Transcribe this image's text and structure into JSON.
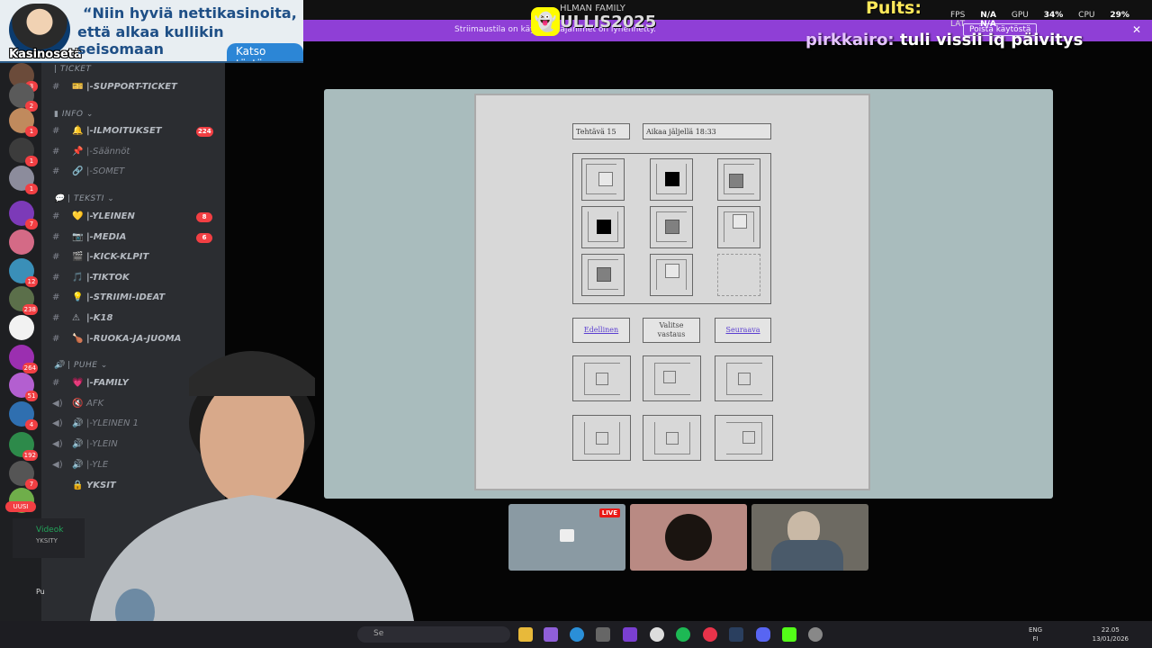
{
  "ad": {
    "logo": "Kasinosetä",
    "line1": "“Niin hyviä nettikasinoita,",
    "line2": "että alkaa kullikin seisomaan",
    "cta": "Katso tästä"
  },
  "topbar": {
    "group_name": "HLMAN FAMILY",
    "stream_username": "ULLIS2025"
  },
  "stream_banner": {
    "message": "Striimaustila on käy… …ttajanimet on lyhennetty.",
    "button": "Poista käytöstä",
    "close": "✕"
  },
  "overlay": {
    "name": "Pults:",
    "stats": [
      {
        "label": "FPS",
        "value": "N/A"
      },
      {
        "label": "GPU",
        "value": "34%"
      },
      {
        "label": "CPU",
        "value": "29%"
      },
      {
        "label": "LAT",
        "value": "N/A"
      }
    ],
    "chat_user": "pirkkairo:",
    "chat_message": "tuli vissii iq päivitys"
  },
  "sidebar": {
    "categories": [
      {
        "label": "TICKET"
      },
      {
        "label": "INFO"
      },
      {
        "label": "TEKSTI"
      },
      {
        "label": "PUHE"
      }
    ],
    "channels": [
      {
        "name": "|-SUPPORT-TICKET",
        "emoji": "🎫"
      },
      {
        "name": "|-ILMOITUKSET",
        "emoji": "🔔",
        "count": "224"
      },
      {
        "name": "|-Säännöt",
        "emoji": "📌"
      },
      {
        "name": "|-SOMET",
        "emoji": "🔗"
      },
      {
        "name": "|-YLEINEN",
        "emoji": "💛",
        "count": "8"
      },
      {
        "name": "|-MEDIA",
        "emoji": "📷",
        "count": "6"
      },
      {
        "name": "|-KICK-KLPIT",
        "emoji": "🎬"
      },
      {
        "name": "|-TIKTOK",
        "emoji": "🎵"
      },
      {
        "name": "|-STRIIMI-IDEAT",
        "emoji": "💡"
      },
      {
        "name": "|-K18",
        "emoji": "⚠"
      },
      {
        "name": "|-RUOKA-JA-JUOMA",
        "emoji": "🍗"
      },
      {
        "name": "|-FAMILY",
        "emoji": "💗"
      },
      {
        "name": "AFK",
        "emoji": "🔇"
      },
      {
        "name": "|-YLEINEN 1",
        "emoji": "🔊"
      },
      {
        "name": "|-YLEIN",
        "emoji": "🔊"
      },
      {
        "name": "|-YLE",
        "emoji": "🔊"
      },
      {
        "name": "YKSIT",
        "emoji": "🔒"
      }
    ],
    "server_badges": [
      "3",
      "2",
      "1",
      "1",
      "1",
      "1",
      "7",
      "12",
      "238",
      "264",
      "51",
      "4",
      "192",
      "7"
    ],
    "new_label": "UUSI",
    "voice_label": "Videok",
    "voice_sub": "YKSITY",
    "user_label": "Pu"
  },
  "task": {
    "task_label": "Tehtävä 15",
    "time_label": "Aikaa jäljellä 18:33",
    "prev": "Edellinen",
    "choose_line1": "Valitse",
    "choose_line2": "vastaus",
    "next": "Seuraava"
  },
  "participants": {
    "live": "LIVE"
  },
  "taskbar": {
    "search": "Se",
    "lang_line1": "ENG",
    "lang_line2": "FI",
    "time": "22.05",
    "date": "13/01/2026"
  },
  "colors": {
    "banner": "#8f3fd6",
    "discord_sidebar": "#2b2d31",
    "discord_servers": "#1e1f22",
    "share_bg": "#a9bcbd",
    "overlay_yellow": "#ffe95a"
  }
}
